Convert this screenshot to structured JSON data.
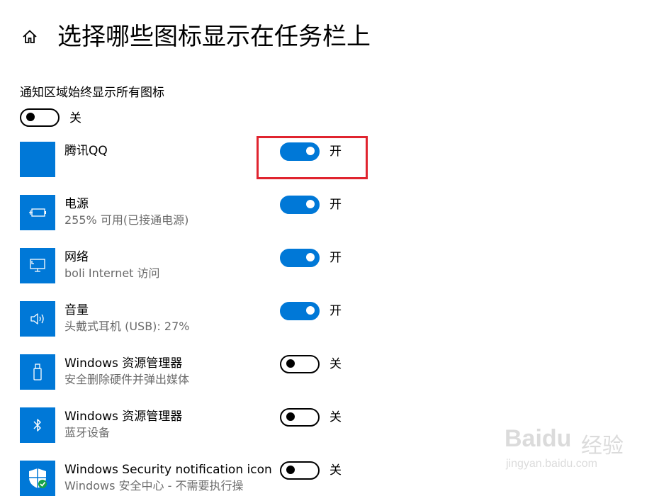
{
  "header": {
    "title": "选择哪些图标显示在任务栏上",
    "home_icon": "home-icon"
  },
  "master": {
    "label": "通知区域始终显示所有图标",
    "state": "关",
    "on": false
  },
  "rows": [
    {
      "name": "腾讯QQ",
      "sub": "",
      "state": "开",
      "on": true,
      "icon": "qq-icon"
    },
    {
      "name": "电源",
      "sub": "255% 可用(已接通电源)",
      "state": "开",
      "on": true,
      "icon": "battery-icon"
    },
    {
      "name": "网络",
      "sub": "boli Internet 访问",
      "state": "开",
      "on": true,
      "icon": "network-icon"
    },
    {
      "name": "音量",
      "sub": "头戴式耳机 (USB): 27%",
      "state": "开",
      "on": true,
      "icon": "volume-icon"
    },
    {
      "name": "Windows 资源管理器",
      "sub": "安全删除硬件并弹出媒体",
      "state": "关",
      "on": false,
      "icon": "usb-icon"
    },
    {
      "name": "Windows 资源管理器",
      "sub": "蓝牙设备",
      "state": "关",
      "on": false,
      "icon": "bluetooth-icon"
    },
    {
      "name": "Windows Security notification icon",
      "sub": "Windows 安全中心 - 不需要执行操",
      "state": "关",
      "on": false,
      "icon": "shield-icon"
    }
  ],
  "watermark": {
    "brand": "Baidu",
    "brand_cn": "经验",
    "url": "jingyan.baidu.com"
  },
  "colors": {
    "accent": "#0078d7",
    "highlight": "#e0242f"
  }
}
